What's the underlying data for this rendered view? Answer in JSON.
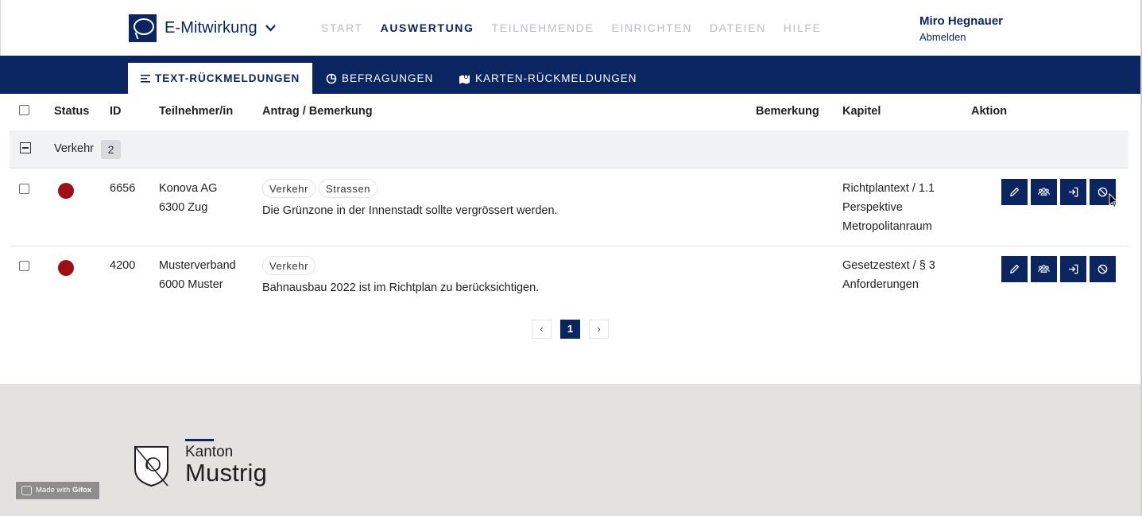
{
  "header": {
    "brand_title": "E-Mitwirkung",
    "nav": [
      "START",
      "AUSWERTUNG",
      "TEILNEHMENDE",
      "EINRICHTEN",
      "DATEIEN",
      "HILFE"
    ],
    "nav_active_index": 1,
    "user_name": "Miro Hegnauer",
    "logout": "Abmelden"
  },
  "subnav": {
    "tabs": [
      {
        "label": "TEXT-RÜCKMELDUNGEN",
        "icon": "text-lines-icon",
        "active": true
      },
      {
        "label": "BEFRAGUNGEN",
        "icon": "chart-pie-icon",
        "active": false
      },
      {
        "label": "KARTEN-RÜCKMELDUNGEN",
        "icon": "map-marker-icon",
        "active": false
      }
    ]
  },
  "table": {
    "columns": {
      "status": "Status",
      "id": "ID",
      "participant": "Teilnehmer/in",
      "motion": "Antrag / Bemerkung",
      "remark": "Bemerkung",
      "chapter": "Kapitel",
      "action": "Aktion"
    },
    "group": {
      "label": "Verkehr",
      "count": "2"
    },
    "rows": [
      {
        "status_color": "#a10f16",
        "id": "6656",
        "participant_line1": "Konova AG",
        "participant_line2": "6300 Zug",
        "tags": [
          "Verkehr",
          "Strassen"
        ],
        "text": "Die Grünzone in der Innenstadt sollte vergrössert werden.",
        "chapter_line1": "Richtplantext / 1.1",
        "chapter_line2": "Perspektive",
        "chapter_line3": "Metropolitanraum"
      },
      {
        "status_color": "#a10f16",
        "id": "4200",
        "participant_line1": "Musterverband",
        "participant_line2": "6000 Muster",
        "tags": [
          "Verkehr"
        ],
        "text": "Bahnausbau 2022 ist im Richtplan zu berücksichtigen.",
        "chapter_line1": "Gesetzestext / § 3",
        "chapter_line2": "Anforderungen"
      }
    ],
    "action_icons": [
      "pencil-icon",
      "group-icon",
      "sign-in-icon",
      "ban-icon"
    ]
  },
  "pagination": {
    "prev": "‹",
    "current": "1",
    "next": "›"
  },
  "footer": {
    "kanton_line1": "Kanton",
    "kanton_line2": "Mustrig",
    "gifox_prefix": "Made with ",
    "gifox_brand": "Gifox"
  },
  "colors": {
    "primary": "#0b2560",
    "status_red": "#a10f16",
    "footer_bg": "#e3e2df"
  }
}
